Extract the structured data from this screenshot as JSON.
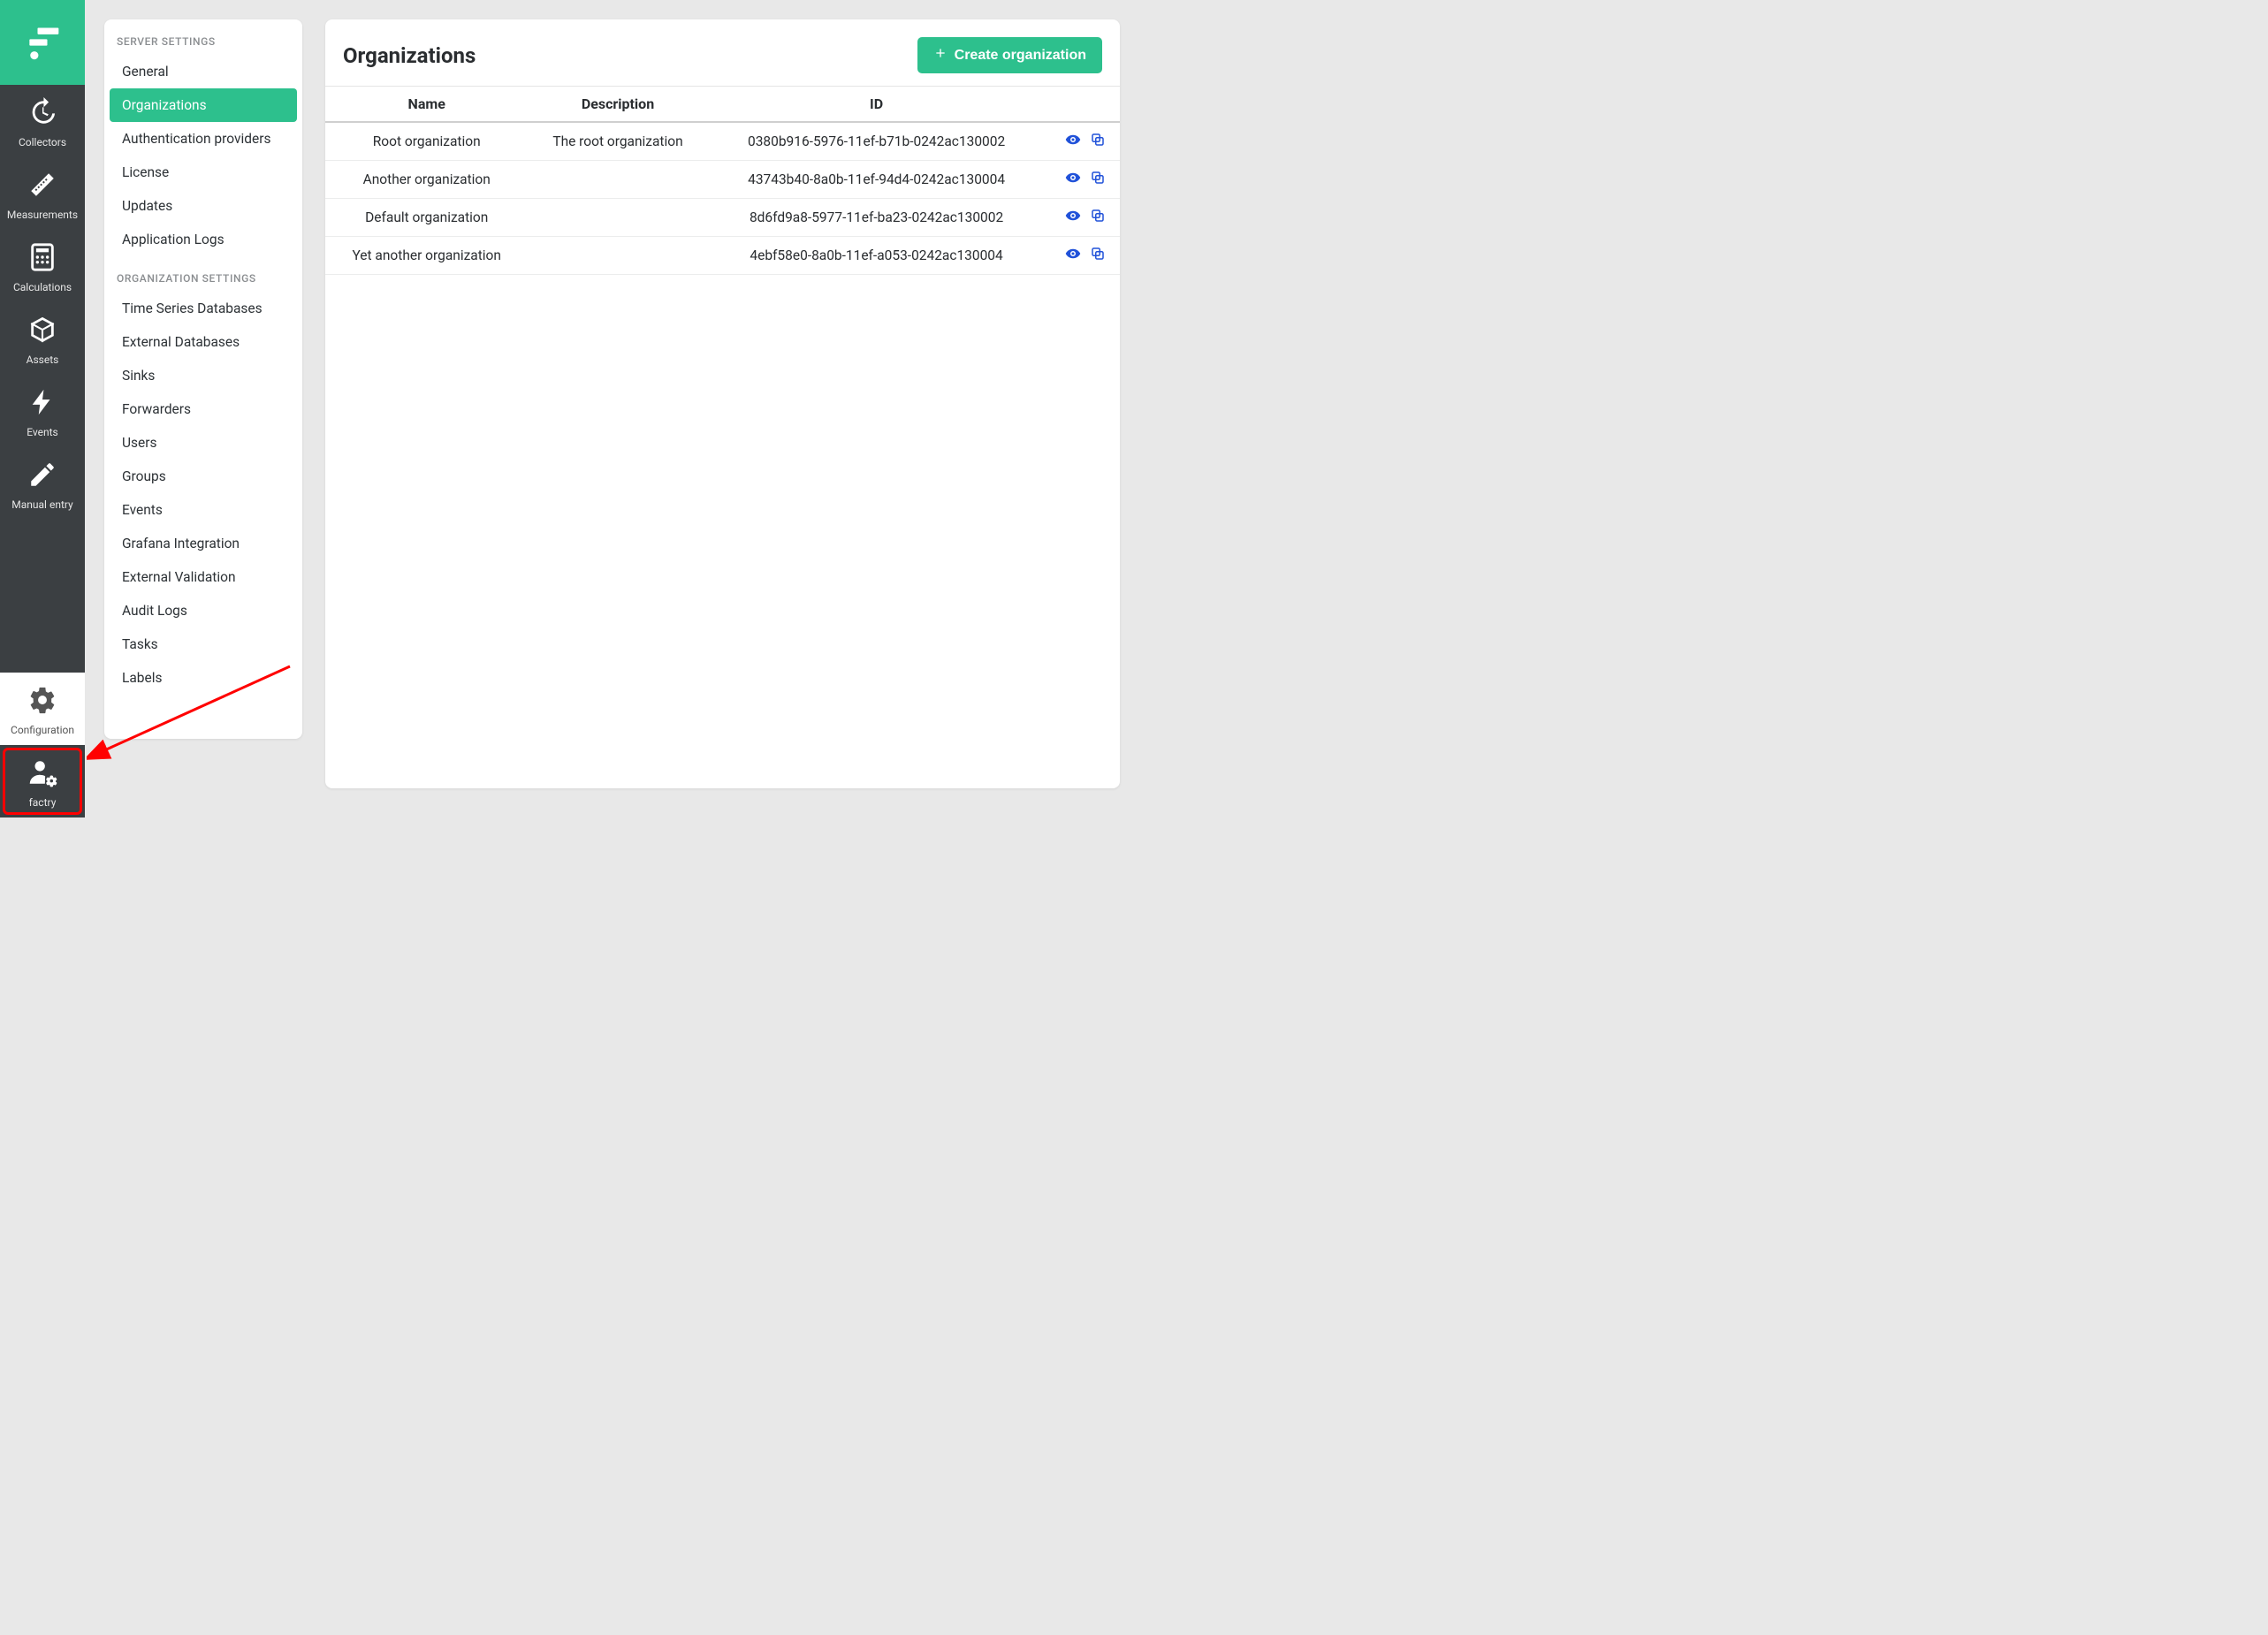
{
  "nav": {
    "items": [
      {
        "label": "Collectors",
        "icon": "history"
      },
      {
        "label": "Measurements",
        "icon": "ruler"
      },
      {
        "label": "Calculations",
        "icon": "calculator"
      },
      {
        "label": "Assets",
        "icon": "cube"
      },
      {
        "label": "Events",
        "icon": "bolt"
      },
      {
        "label": "Manual entry",
        "icon": "pencil"
      }
    ],
    "config_label": "Configuration",
    "user_label": "factry"
  },
  "settings": {
    "groups": [
      {
        "title": "SERVER SETTINGS",
        "items": [
          "General",
          "Organizations",
          "Authentication providers",
          "License",
          "Updates",
          "Application Logs"
        ],
        "active_index": 1
      },
      {
        "title": "ORGANIZATION SETTINGS",
        "items": [
          "Time Series Databases",
          "External Databases",
          "Sinks",
          "Forwarders",
          "Users",
          "Groups",
          "Events",
          "Grafana Integration",
          "External Validation",
          "Audit Logs",
          "Tasks",
          "Labels"
        ],
        "active_index": -1
      }
    ]
  },
  "main": {
    "title": "Organizations",
    "create_label": "Create organization",
    "columns": [
      "Name",
      "Description",
      "ID"
    ],
    "rows": [
      {
        "name": "Root organization",
        "description": "The root organization",
        "id": "0380b916-5976-11ef-b71b-0242ac130002"
      },
      {
        "name": "Another organization",
        "description": "",
        "id": "43743b40-8a0b-11ef-94d4-0242ac130004"
      },
      {
        "name": "Default organization",
        "description": "",
        "id": "8d6fd9a8-5977-11ef-ba23-0242ac130002"
      },
      {
        "name": "Yet another organization",
        "description": "",
        "id": "4ebf58e0-8a0b-11ef-a053-0242ac130004"
      }
    ]
  }
}
